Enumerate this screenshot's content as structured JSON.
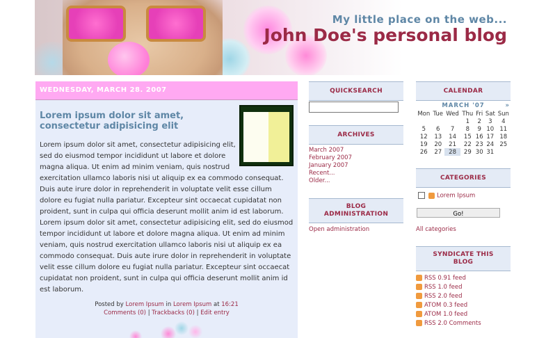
{
  "header": {
    "tagline": "My little place on the web...",
    "title": "John Doe's personal blog"
  },
  "post": {
    "date": "WEDNESDAY, MARCH 28. 2007",
    "title": "Lorem ipsum dolor sit amet, consectetur adipisicing elit",
    "body": "Lorem ipsum dolor sit amet, consectetur adipisicing elit, sed do eiusmod tempor incididunt ut labore et dolore magna aliqua. Ut enim ad minim veniam, quis nostrud exercitation ullamco laboris nisi ut aliquip ex ea commodo consequat. Duis aute irure dolor in reprehenderit in voluptate velit esse cillum dolore eu fugiat nulla pariatur. Excepteur sint occaecat cupidatat non proident, sunt in culpa qui officia deserunt mollit anim id est laborum. Lorem ipsum dolor sit amet, consectetur adipisicing elit, sed do eiusmod tempor incididunt ut labore et dolore magna aliqua. Ut enim ad minim veniam, quis nostrud exercitation ullamco laboris nisi ut aliquip ex ea commodo consequat. Duis aute irure dolor in reprehenderit in voluptate velit esse cillum dolore eu fugiat nulla pariatur. Excepteur sint occaecat cupidatat non proident, sunt in culpa qui officia deserunt mollit anim id est laborum.",
    "posted_by": "Posted by",
    "author": "Lorem Ipsum",
    "in": "in",
    "category": "Lorem Ipsum",
    "at": "at",
    "time": "16:21",
    "comments": "Comments (0)",
    "trackbacks": "Trackbacks (0)",
    "edit": "Edit entry",
    "sep": "|"
  },
  "quicksearch": {
    "heading": "QUICKSEARCH",
    "value": ""
  },
  "archives": {
    "heading": "ARCHIVES",
    "items": [
      "March 2007",
      "February 2007",
      "January 2007",
      "Recent...",
      "Older..."
    ]
  },
  "admin": {
    "heading_line1": "BLOG",
    "heading_line2": "ADMINISTRATION",
    "link": "Open administration"
  },
  "calendar": {
    "heading": "CALENDAR",
    "month": "MARCH '07",
    "next": "»",
    "days": [
      "Mon",
      "Tue",
      "Wed",
      "Thu",
      "Fri",
      "Sat",
      "Sun"
    ],
    "weeks": [
      [
        "",
        "",
        "",
        "1",
        "2",
        "3",
        "4"
      ],
      [
        "5",
        "6",
        "7",
        "8",
        "9",
        "10",
        "11"
      ],
      [
        "12",
        "13",
        "14",
        "15",
        "16",
        "17",
        "18"
      ],
      [
        "19",
        "20",
        "21",
        "22",
        "23",
        "24",
        "25"
      ],
      [
        "26",
        "27",
        "28",
        "29",
        "30",
        "31",
        ""
      ]
    ],
    "today": "28"
  },
  "categories": {
    "heading": "CATEGORIES",
    "item": "Lorem Ipsum",
    "go": "Go!",
    "all": "All categories"
  },
  "syndicate": {
    "heading_line1": "SYNDICATE THIS",
    "heading_line2": "BLOG",
    "feeds": [
      "RSS 0.91 feed",
      "RSS 1.0 feed",
      "RSS 2.0 feed",
      "ATOM 0.3 feed",
      "ATOM 1.0 feed",
      "RSS 2.0 Comments"
    ]
  }
}
